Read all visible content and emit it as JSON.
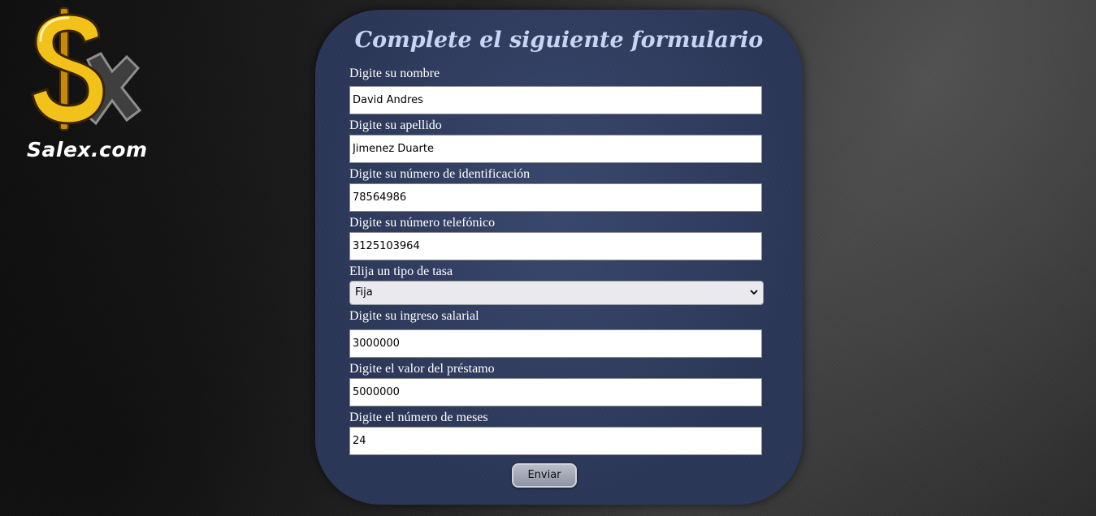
{
  "brand": {
    "logo_text": "Salex.com",
    "colors": {
      "dollar_gold": "#f2c21b",
      "x_gray": "#4a4a4a"
    }
  },
  "form": {
    "title": "Complete el siguiente formulario",
    "fields": [
      {
        "label": "Digite su nombre",
        "value": "David Andres"
      },
      {
        "label": "Digite su apellido",
        "value": "Jimenez Duarte"
      },
      {
        "label": "Digite su número de identificación",
        "value": "78564986"
      },
      {
        "label": "Digite su número telefónico",
        "value": "3125103964"
      }
    ],
    "rate": {
      "label": "Elija un tipo de tasa",
      "selected": "Fija",
      "icon": "chevron-down-icon"
    },
    "fields2": [
      {
        "label": "Digite su ingreso salarial",
        "value": "3000000"
      },
      {
        "label": "Digite el valor del préstamo",
        "value": "5000000"
      },
      {
        "label": "Digite el número de meses",
        "value": "24"
      }
    ],
    "submit_label": "Enviar"
  },
  "theme": {
    "panel_color": "#2a3657",
    "title_color": "#c9d4f2",
    "label_color": "#ffffff"
  }
}
